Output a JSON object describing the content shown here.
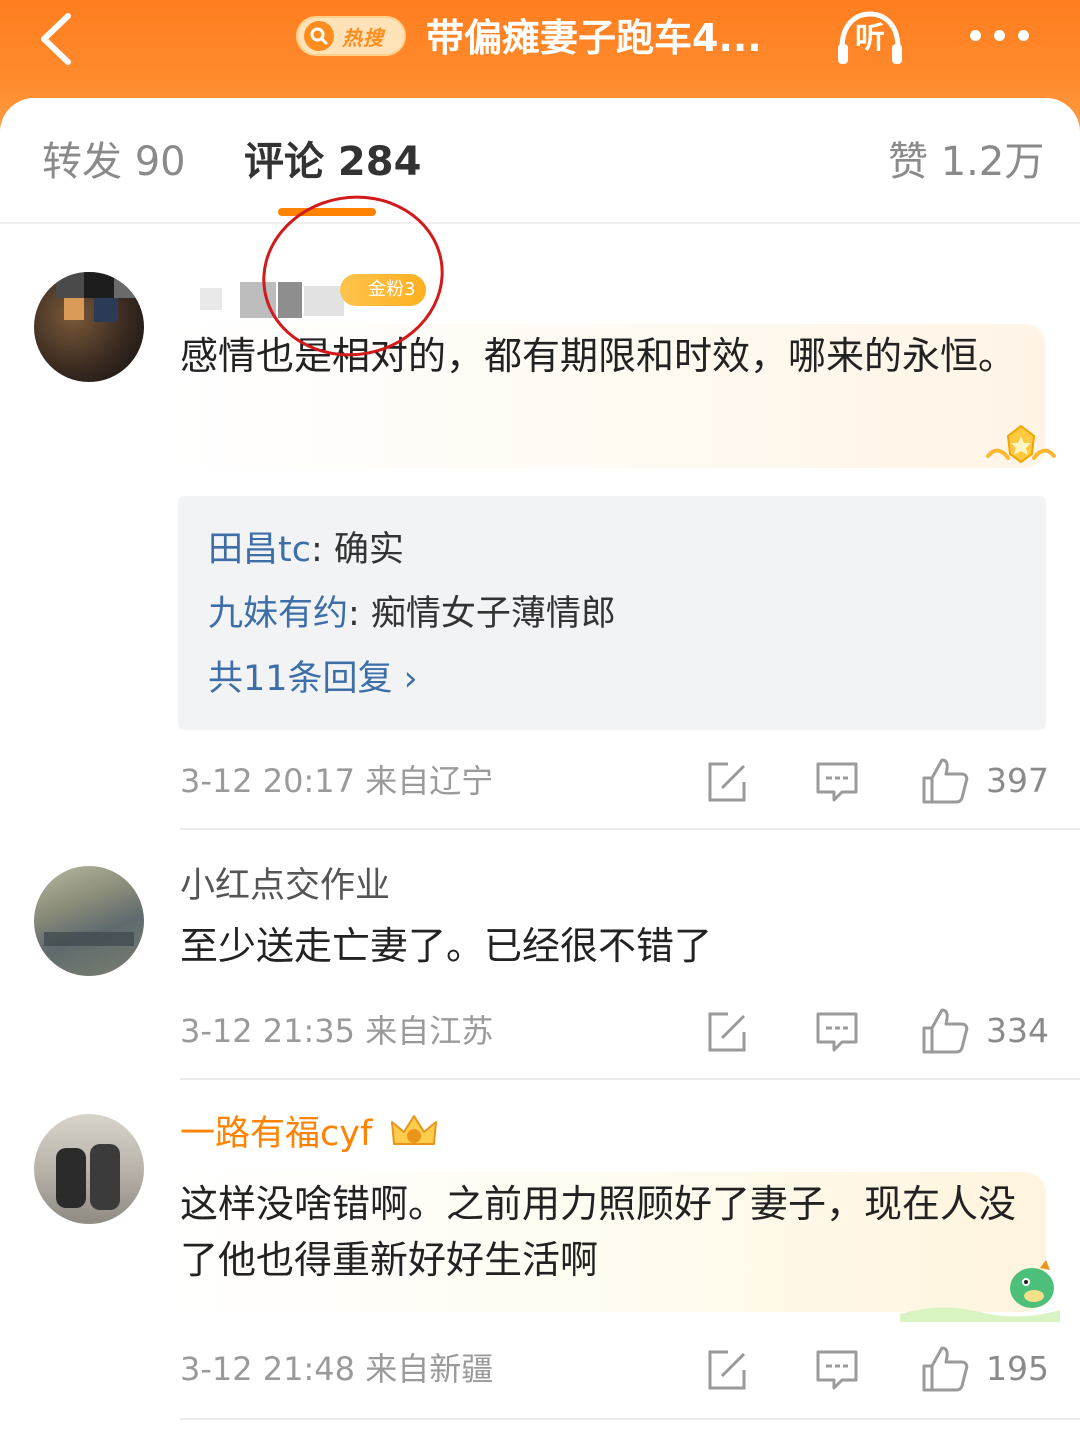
{
  "header": {
    "hot_badge": "热搜",
    "title": "带偏瘫妻子跑车4...",
    "listen_label": "听"
  },
  "tabs": [
    {
      "label": "转发 90"
    },
    {
      "label": "评论 284"
    },
    {
      "label": "赞 1.2万"
    }
  ],
  "colors": {
    "brand_orange": "#ff8200",
    "link_blue": "#3d6ea8",
    "annotation_red": "#d21a1a"
  },
  "comments": [
    {
      "username": "",
      "badge": "金粉3",
      "text": "感情也是相对的，都有期限和时效，哪来的永恒。",
      "replies": [
        {
          "user": "田昌tc",
          "text": ": 确实"
        },
        {
          "user": "九妹有约",
          "text": ": 痴情女子薄情郎"
        }
      ],
      "more_replies": "共11条回复 ›",
      "time": "3-12 20:17 来自辽宁",
      "likes": "397"
    },
    {
      "username": "小红点交作业",
      "text": "至少送走亡妻了。已经很不错了",
      "time": "3-12 21:35 来自江苏",
      "likes": "334"
    },
    {
      "username": "一路有福cyf",
      "text": "这样没啥错啊。之前用力照顾好了妻子，现在人没了他也得重新好好生活啊",
      "time": "3-12 21:48 来自新疆",
      "likes": "195"
    }
  ],
  "icons": [
    "back-icon",
    "search-icon",
    "headphones-icon",
    "more-icon",
    "share-icon",
    "comment-icon",
    "like-icon",
    "vip-crown-icon",
    "gold-star-decoration-icon",
    "dinosaur-sticker-icon"
  ]
}
